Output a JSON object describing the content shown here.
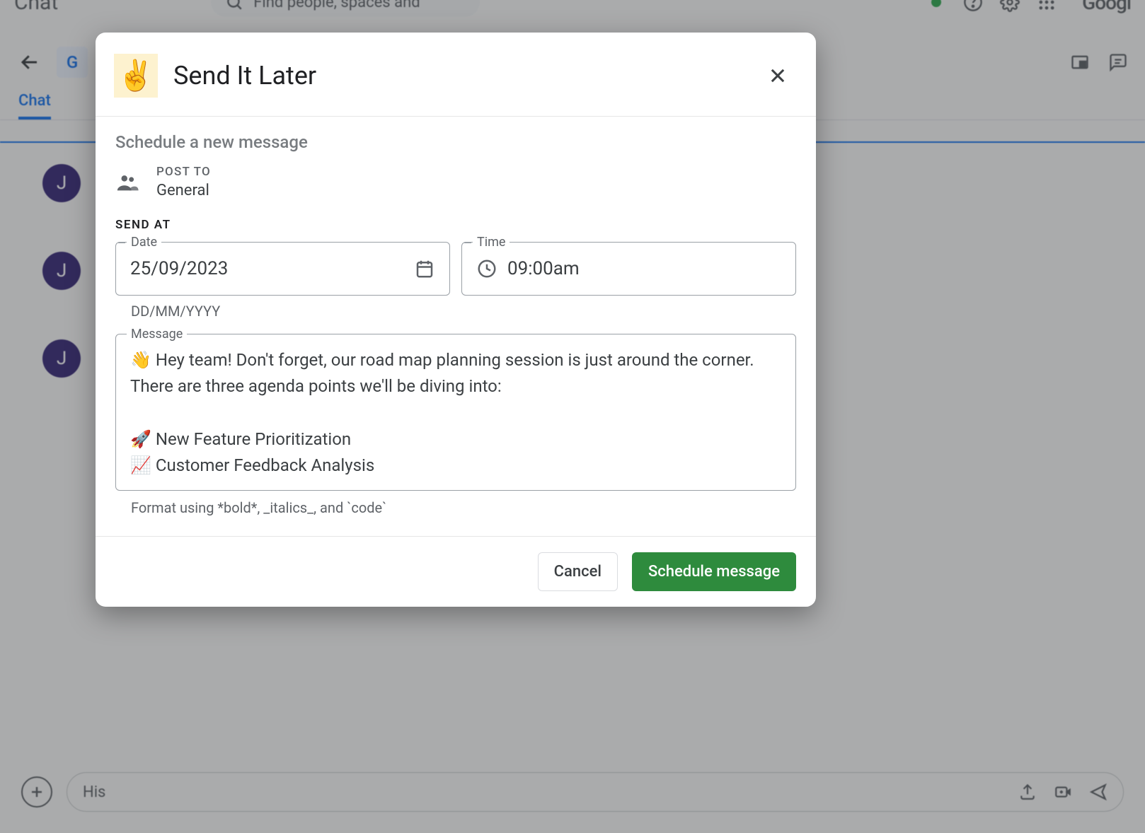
{
  "background": {
    "app_name": "Chat",
    "search_placeholder": "Find people, spaces and",
    "brand": "Googl",
    "avatar_letter_top": "G",
    "tab_label": "Chat",
    "msg_avatar_letter": "J",
    "compose_placeholder": "His"
  },
  "modal": {
    "emoji": "✌️",
    "title": "Send It Later",
    "subtitle": "Schedule a new message",
    "post_to_label": "POST TO",
    "post_to_value": "General",
    "send_at_label": "SEND AT",
    "date_legend": "Date",
    "date_value": "25/09/2023",
    "date_helper": "DD/MM/YYYY",
    "time_legend": "Time",
    "time_value": "09:00am",
    "message_legend": "Message",
    "message_value": "👋 Hey team! Don't forget, our road map planning session is just around the corner. There are three agenda points we'll be diving into:\n\n🚀 New Feature Prioritization\n📈 Customer Feedback Analysis",
    "format_help": "Format using *bold*, _italics_, and `code`",
    "cancel_label": "Cancel",
    "submit_label": "Schedule message"
  }
}
